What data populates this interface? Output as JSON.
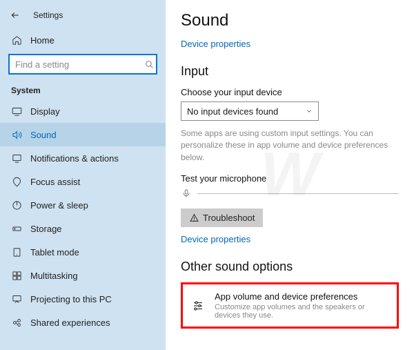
{
  "header": {
    "app_title": "Settings"
  },
  "sidebar": {
    "home_label": "Home",
    "search_placeholder": "Find a setting",
    "section_label": "System",
    "items": [
      {
        "label": "Display"
      },
      {
        "label": "Sound"
      },
      {
        "label": "Notifications & actions"
      },
      {
        "label": "Focus assist"
      },
      {
        "label": "Power & sleep"
      },
      {
        "label": "Storage"
      },
      {
        "label": "Tablet mode"
      },
      {
        "label": "Multitasking"
      },
      {
        "label": "Projecting to this PC"
      },
      {
        "label": "Shared experiences"
      }
    ]
  },
  "main": {
    "page_title": "Sound",
    "device_props_link": "Device properties",
    "input_section": "Input",
    "choose_input_label": "Choose your input device",
    "input_device_selected": "No input devices found",
    "input_hint": "Some apps are using custom input settings. You can personalize these in app volume and device preferences below.",
    "test_mic_label": "Test your microphone",
    "troubleshoot_label": "Troubleshoot",
    "device_props_link2": "Device properties",
    "other_section": "Other sound options",
    "card_title": "App volume and device preferences",
    "card_sub": "Customize app volumes and the speakers or devices they use."
  }
}
